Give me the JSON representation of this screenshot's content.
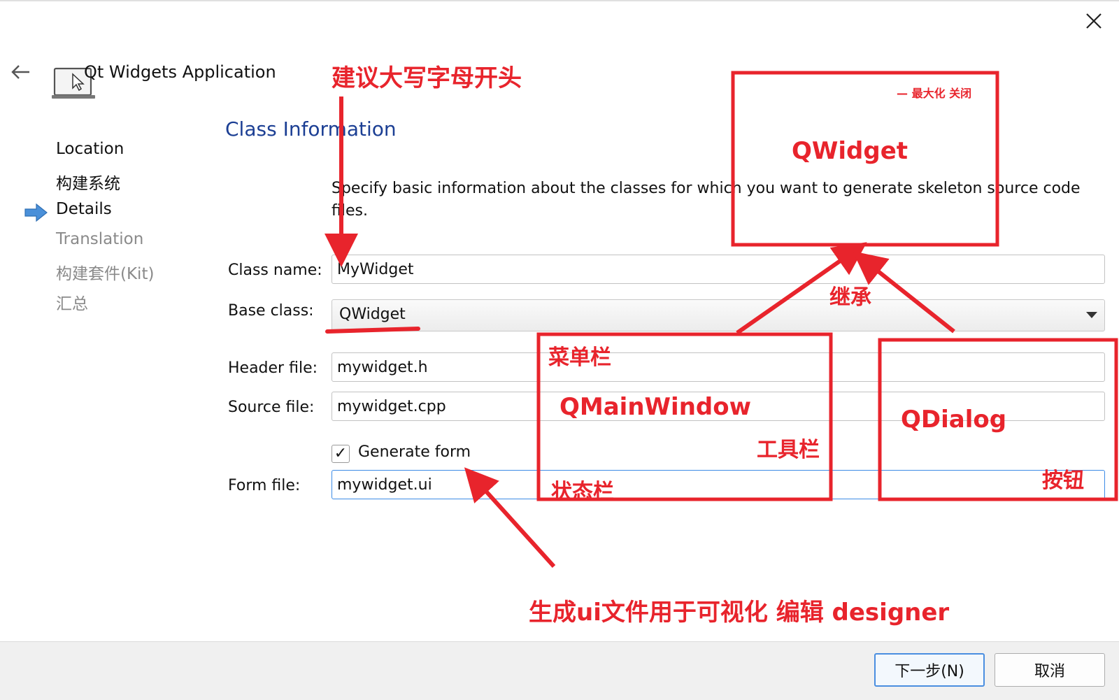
{
  "wizard": {
    "title": "Qt Widgets Application",
    "close_icon": "close-icon",
    "back_icon": "back-arrow-icon",
    "app_icon": "laptop-cursor-icon"
  },
  "nav": {
    "items": [
      {
        "label": "Location",
        "state": "done"
      },
      {
        "label": "构建系统",
        "state": "done"
      },
      {
        "label": "Details",
        "state": "current"
      },
      {
        "label": "Translation",
        "state": "future"
      },
      {
        "label": "构建套件(Kit)",
        "state": "future"
      },
      {
        "label": "汇总",
        "state": "future"
      }
    ],
    "current_marker_icon": "arrow-right-icon"
  },
  "page": {
    "section_title": "Class Information",
    "description": "Specify basic information about the classes for which you want to generate skeleton source code files.",
    "fields": {
      "class_name": {
        "label": "Class name:",
        "value": "MyWidget"
      },
      "base_class": {
        "label": "Base class:",
        "value": "QWidget"
      },
      "header_file": {
        "label": "Header file:",
        "value": "mywidget.h"
      },
      "source_file": {
        "label": "Source file:",
        "value": "mywidget.cpp"
      },
      "generate_form": {
        "label": "Generate form",
        "checked": true,
        "check_mark": "✓"
      },
      "form_file": {
        "label": "Form file:",
        "value": "mywidget.ui"
      }
    }
  },
  "buttons": {
    "next": "下一步(N)",
    "cancel": "取消"
  },
  "annotations": {
    "color": "#e8242c",
    "capitalize_note": "建议大写字母开头",
    "qwidget_box": {
      "title_bar": "— 最大化 关闭",
      "name": "QWidget"
    },
    "inherit": "继承",
    "qmainwindow_box": {
      "menubar": "菜单栏",
      "name": "QMainWindow",
      "toolbar": "工具栏",
      "statusbar": "状态栏"
    },
    "qdialog_box": {
      "name": "QDialog",
      "buttons": "按钮"
    },
    "generate_ui_note": "生成ui文件用于可视化  编辑   designer"
  },
  "colors": {
    "section_title": "#1c3f94",
    "focus_border": "#3c8be6",
    "nav_future": "#8a8a8a",
    "annotation": "#e8242c"
  }
}
